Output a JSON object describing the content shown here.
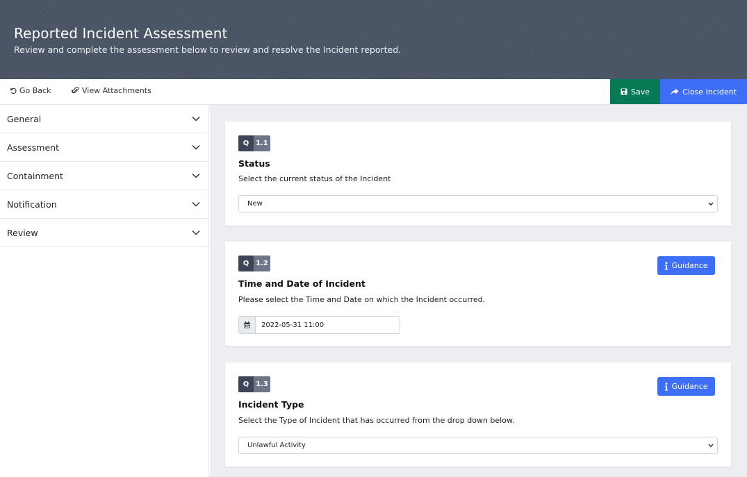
{
  "header": {
    "title": "Reported Incident Assessment",
    "subtitle": "Review and complete the assessment below to review and resolve the Incident reported."
  },
  "toolbar": {
    "go_back": "Go Back",
    "view_attachments": "View Attachments",
    "save": "Save",
    "close_incident": "Close Incident"
  },
  "sidebar": {
    "items": [
      {
        "label": "General"
      },
      {
        "label": "Assessment"
      },
      {
        "label": "Containment"
      },
      {
        "label": "Notification"
      },
      {
        "label": "Review"
      }
    ]
  },
  "questions": [
    {
      "q": "Q",
      "number": "1.1",
      "title": "Status",
      "description": "Select the current status of the Incident",
      "value": "New"
    },
    {
      "q": "Q",
      "number": "1.2",
      "title": "Time and Date of Incident",
      "description": "Please select the Time and Date on which the Incident occurred.",
      "value": "2022-05-31 11:00",
      "guidance": "Guidance"
    },
    {
      "q": "Q",
      "number": "1.3",
      "title": "Incident Type",
      "description": "Select the Type of Incident that has occurred from the drop down below.",
      "value": "Unlawful Activity",
      "guidance": "Guidance"
    }
  ],
  "colors": {
    "header_bg": "#4a5566",
    "save_green": "#077955",
    "primary_blue": "#3d6ef5",
    "badge_dark": "#3c4658",
    "badge_gray": "#6d7687",
    "main_bg": "#eceef1"
  },
  "icons": {
    "go_back": "undo-icon",
    "view_attachments": "paperclip-icon",
    "save": "floppy-disk-icon",
    "close_incident": "share-arrow-icon",
    "section_toggle": "chevron-down-icon",
    "select_caret": "chevron-down-icon",
    "guidance": "info-icon",
    "date": "calendar-icon"
  }
}
